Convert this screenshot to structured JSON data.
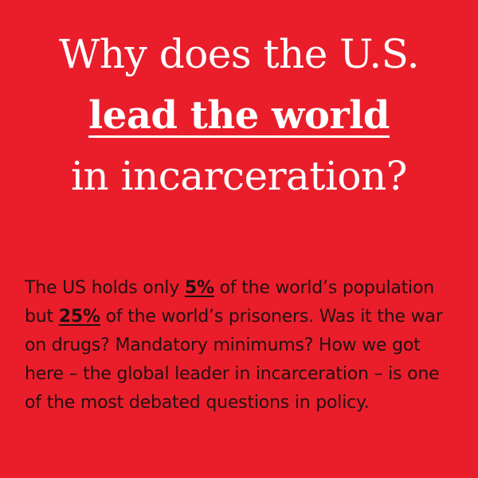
{
  "card": {
    "background_color": "#ea1e2b",
    "headline": {
      "line1": "Why does the U.S.",
      "line2_emphasis": "lead the world",
      "line3": "in incarceration?"
    },
    "body": {
      "part1": "The US holds only ",
      "stat1": "5%",
      "part2": " of the world’s population but ",
      "stat2": "25%",
      "part3": " of the world’s prisoners. Was it the war on drugs? Mandatory minimums? How we got here – the global leader in incarceration – is one of the most debated questions in policy."
    }
  }
}
